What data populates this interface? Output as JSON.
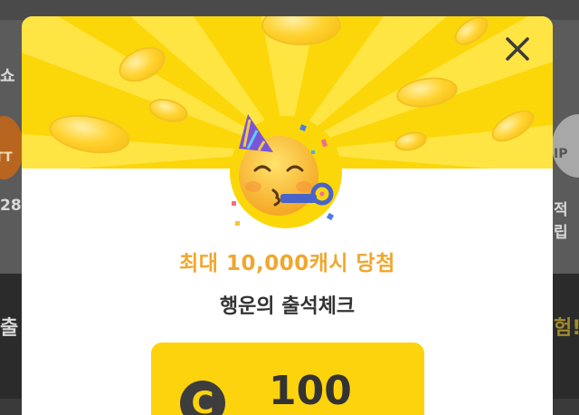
{
  "background": {
    "header_partial_left": "쇼",
    "tt_badge_text": "TT",
    "value_partial_left": "28",
    "vip_badge_text": "IP",
    "reward_partial_right": "적립",
    "bottom_partial_left": "출",
    "bottom_partial_right": "험!"
  },
  "modal": {
    "close_icon": "close-icon",
    "emoji_icon": "party-face-icon",
    "prize_text": "최대 10,000캐시 당첨",
    "title": "행운의 출석체크",
    "reward": {
      "currency_symbol": "C",
      "amount": "100"
    }
  },
  "colors": {
    "accent_yellow": "#fbd70a",
    "prize_orange": "#f0a72d",
    "card_yellow": "#fdd30e",
    "dark_text": "#333333"
  }
}
